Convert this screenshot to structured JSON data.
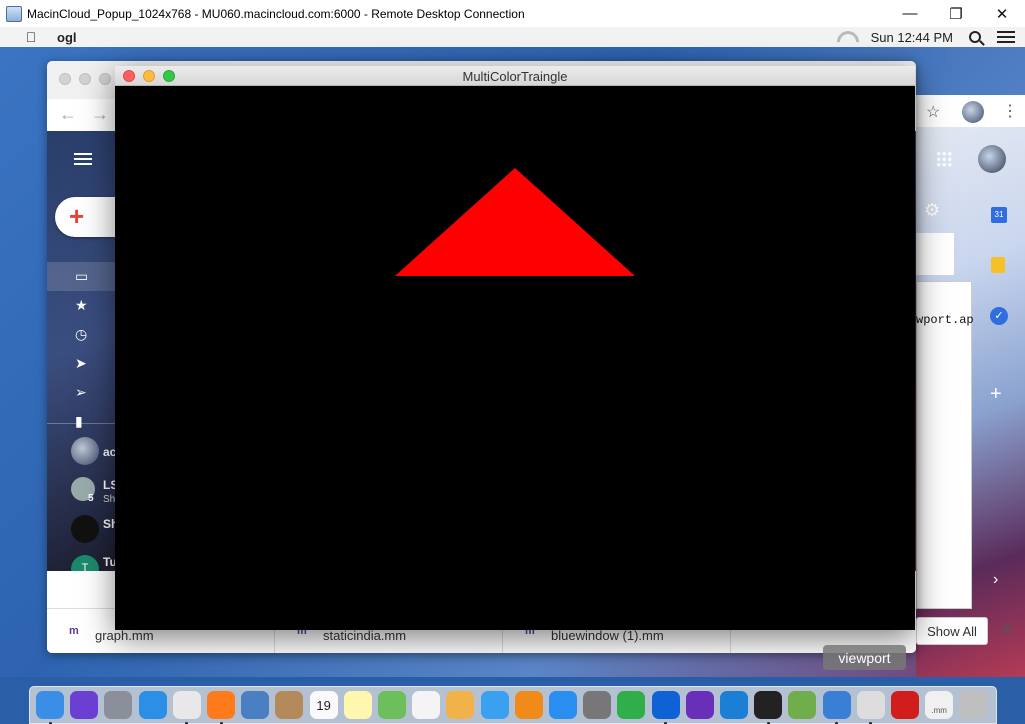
{
  "rdp": {
    "title": "MacinCloud_Popup_1024x768 - MU060.macincloud.com:6000 - Remote Desktop Connection",
    "controls": {
      "minimize": "—",
      "restore": "❐",
      "close": "✕"
    }
  },
  "menubar": {
    "apple": "",
    "app_name": "ogl",
    "clock": "Sun 12:44 PM"
  },
  "gl_window": {
    "title": "MultiColorTraingle",
    "triangle_color": "#ff0000",
    "background_color": "#000000"
  },
  "chrome": {
    "back": "←",
    "forward": "→",
    "sidebar_icons": [
      "inbox-icon",
      "star-icon",
      "clock-icon",
      "label-icon",
      "send-icon",
      "file-icon"
    ],
    "chat": [
      {
        "name": "ac"
      },
      {
        "name": "LS",
        "sub": "Sh",
        "count": "5"
      },
      {
        "name": "Sh"
      },
      {
        "name": "Tu",
        "initial": "T"
      }
    ],
    "right_text": "wport.ap",
    "calendar_day": "31"
  },
  "downloads": {
    "items": [
      {
        "file": "graph.mm",
        "icon": "m"
      },
      {
        "file": "staticindia.mm",
        "icon": "m"
      },
      {
        "file": "bluewindow (1).mm",
        "icon": "m"
      }
    ],
    "show_all": "Show All",
    "close": "✕",
    "chevron": "^"
  },
  "tooltip": "viewport",
  "dock": {
    "apps": [
      "finder-icon",
      "siri-icon",
      "launchpad-icon",
      "safari-icon",
      "chrome-icon",
      "firefox-icon",
      "preview-icon",
      "contacts-icon",
      "calendar-icon",
      "notes-icon",
      "maps-icon",
      "reminders-icon",
      "photos-icon",
      "messages-icon",
      "books-icon",
      "appstore-icon",
      "system-preferences-icon",
      "evernote-icon",
      "dropbox-icon",
      "visual-studio-icon",
      "vscode-icon",
      "terminal-icon",
      "android-studio-icon",
      "xcode-icon",
      "no-entry-icon",
      "acrobat-icon",
      "mm-file-icon",
      "trash-icon"
    ],
    "calendar_day": "19",
    "mm_label": ".mm"
  }
}
